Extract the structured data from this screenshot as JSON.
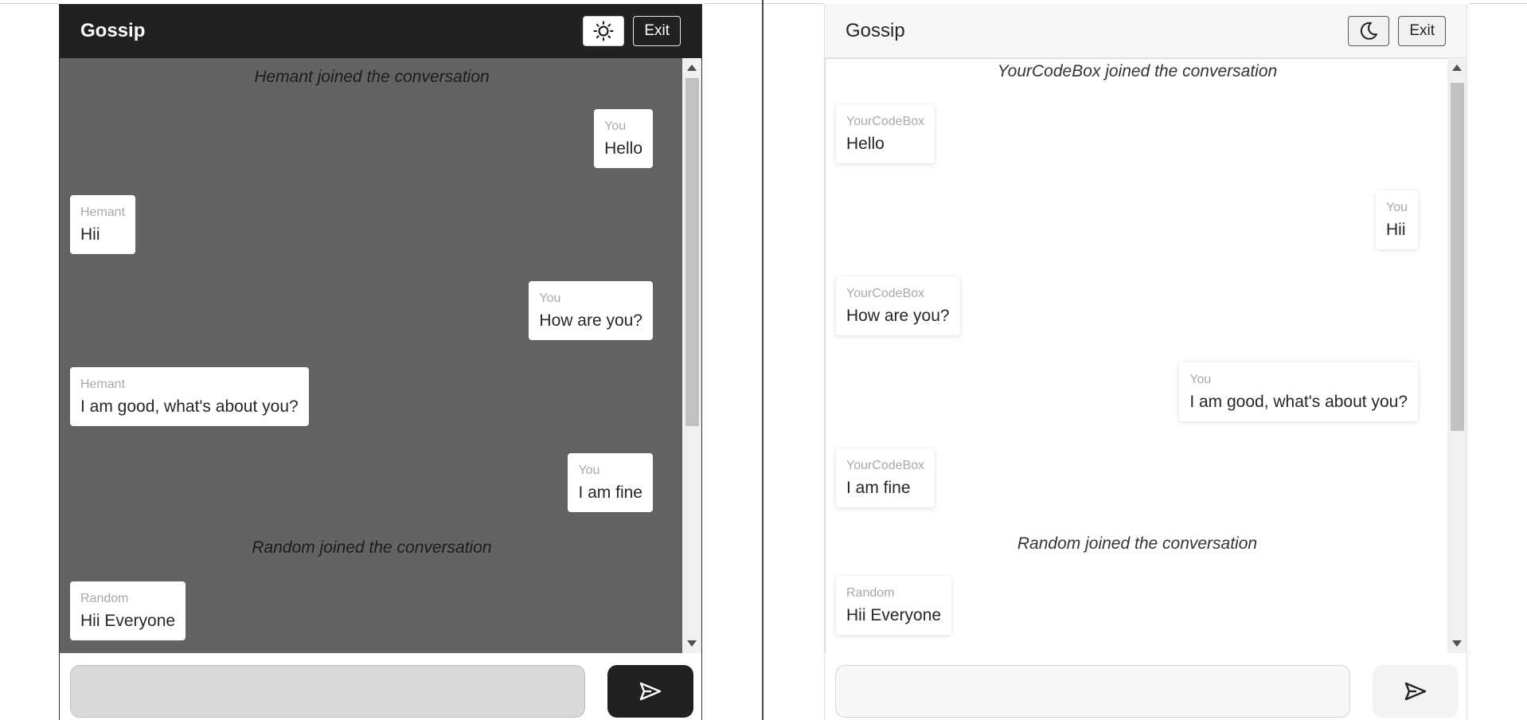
{
  "dark_app": {
    "title": "Gossip",
    "theme_icon": "sun-icon",
    "exit_label": "Exit",
    "send_icon": "send-icon",
    "input_value": "",
    "events": [
      {
        "kind": "join",
        "text": "Hemant joined the conversation"
      },
      {
        "kind": "message",
        "side": "right",
        "sender": "You",
        "text": "Hello"
      },
      {
        "kind": "message",
        "side": "left",
        "sender": "Hemant",
        "text": "Hii"
      },
      {
        "kind": "message",
        "side": "right",
        "sender": "You",
        "text": "How are you?"
      },
      {
        "kind": "message",
        "side": "left",
        "sender": "Hemant",
        "text": "I am good, what's about you?"
      },
      {
        "kind": "message",
        "side": "right",
        "sender": "You",
        "text": "I am fine"
      },
      {
        "kind": "join",
        "text": "Random joined the conversation"
      },
      {
        "kind": "message",
        "side": "left",
        "sender": "Random",
        "text": "Hii Everyone"
      }
    ],
    "colors": {
      "header": "#212121",
      "background": "#636363",
      "bubble": "#ffffff"
    }
  },
  "light_app": {
    "title": "Gossip",
    "theme_icon": "moon-icon",
    "exit_label": "Exit",
    "send_icon": "send-icon",
    "input_value": "",
    "events": [
      {
        "kind": "join",
        "text": "YourCodeBox joined the conversation"
      },
      {
        "kind": "message",
        "side": "left",
        "sender": "YourCodeBox",
        "text": "Hello"
      },
      {
        "kind": "message",
        "side": "right",
        "sender": "You",
        "text": "Hii"
      },
      {
        "kind": "message",
        "side": "left",
        "sender": "YourCodeBox",
        "text": "How are you?"
      },
      {
        "kind": "message",
        "side": "right",
        "sender": "You",
        "text": "I am good, what's about you?"
      },
      {
        "kind": "message",
        "side": "left",
        "sender": "YourCodeBox",
        "text": "I am fine"
      },
      {
        "kind": "join",
        "text": "Random joined the conversation"
      },
      {
        "kind": "message",
        "side": "left",
        "sender": "Random",
        "text": "Hii Everyone"
      }
    ],
    "colors": {
      "header": "#f7f7f8",
      "background": "#ffffff",
      "bubble": "#ffffff"
    }
  }
}
